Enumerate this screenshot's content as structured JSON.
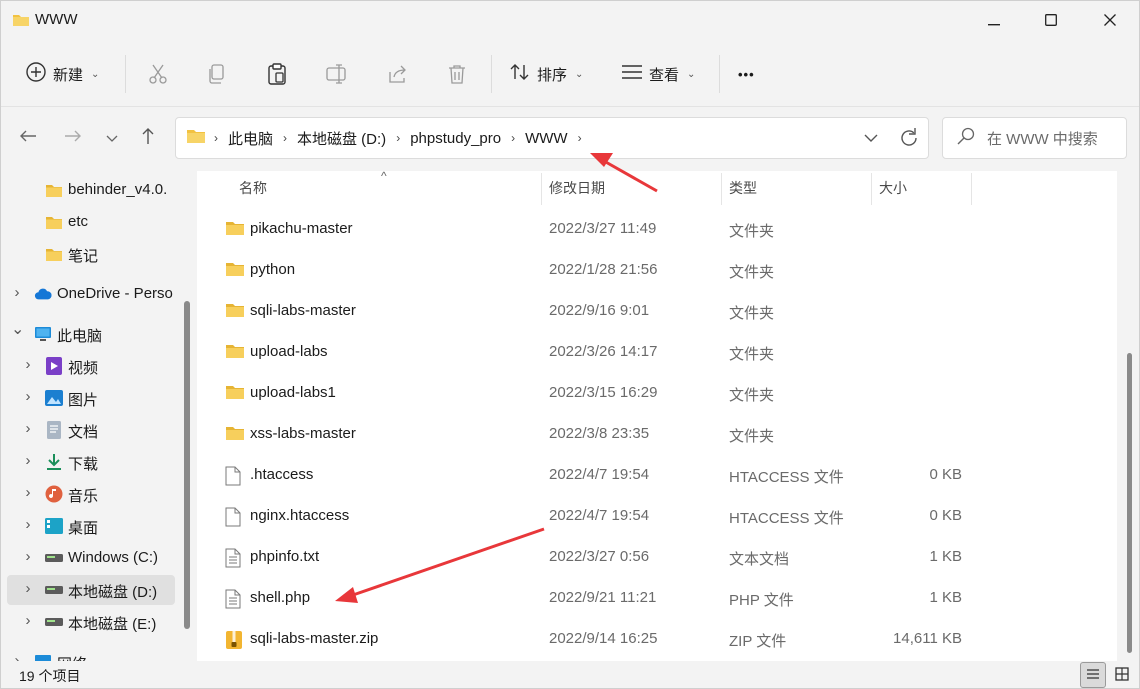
{
  "window": {
    "title": "WWW",
    "minimize_icon": "minimize-icon",
    "maximize_icon": "maximize-icon",
    "close_icon": "close-icon"
  },
  "toolbar": {
    "new_label": "新建",
    "sort_label": "排序",
    "view_label": "查看",
    "more_label": "•••",
    "icons": [
      "plus-circle-icon",
      "cut-icon",
      "copy-icon",
      "paste-icon",
      "rename-icon",
      "share-icon",
      "delete-icon",
      "sort-icon",
      "view-icon",
      "more-icon"
    ]
  },
  "address": {
    "crumbs": [
      "此电脑",
      "本地磁盘 (D:)",
      "phpstudy_pro",
      "WWW"
    ],
    "search_placeholder": "在 WWW 中搜索"
  },
  "sidebar": {
    "items": [
      {
        "label": "behinder_v4.0.",
        "icon": "folder-icon",
        "expandable": false,
        "indent": 1
      },
      {
        "label": "etc",
        "icon": "folder-icon",
        "expandable": false,
        "indent": 1
      },
      {
        "label": "笔记",
        "icon": "folder-icon",
        "expandable": false,
        "indent": 1
      },
      {
        "label": "OneDrive - Perso",
        "icon": "cloud-icon",
        "expandable": true,
        "indent": 0
      },
      {
        "label": "此电脑",
        "icon": "computer-icon",
        "expandable": true,
        "expanded": true,
        "indent": 0
      },
      {
        "label": "视频",
        "icon": "video-icon",
        "expandable": true,
        "indent": 1
      },
      {
        "label": "图片",
        "icon": "picture-icon",
        "expandable": true,
        "indent": 1
      },
      {
        "label": "文档",
        "icon": "document-icon",
        "expandable": true,
        "indent": 1
      },
      {
        "label": "下载",
        "icon": "download-icon",
        "expandable": true,
        "indent": 1
      },
      {
        "label": "音乐",
        "icon": "music-icon",
        "expandable": true,
        "indent": 1
      },
      {
        "label": "桌面",
        "icon": "desktop-icon",
        "expandable": true,
        "indent": 1
      },
      {
        "label": "Windows (C:)",
        "icon": "drive-icon",
        "expandable": true,
        "indent": 1
      },
      {
        "label": "本地磁盘 (D:)",
        "icon": "drive-icon",
        "expandable": true,
        "indent": 1,
        "selected": true
      },
      {
        "label": "本地磁盘 (E:)",
        "icon": "drive-icon",
        "expandable": true,
        "indent": 1
      },
      {
        "label": "网络",
        "icon": "network-icon",
        "expandable": true,
        "indent": 0
      }
    ]
  },
  "columns": {
    "name": "名称",
    "date": "修改日期",
    "type": "类型",
    "size": "大小"
  },
  "files": [
    {
      "name": "pikachu-master",
      "date": "2022/3/27 11:49",
      "type": "文件夹",
      "size": "",
      "icon": "folder-icon"
    },
    {
      "name": "python",
      "date": "2022/1/28 21:56",
      "type": "文件夹",
      "size": "",
      "icon": "folder-icon"
    },
    {
      "name": "sqli-labs-master",
      "date": "2022/9/16 9:01",
      "type": "文件夹",
      "size": "",
      "icon": "folder-icon"
    },
    {
      "name": "upload-labs",
      "date": "2022/3/26 14:17",
      "type": "文件夹",
      "size": "",
      "icon": "folder-icon"
    },
    {
      "name": "upload-labs1",
      "date": "2022/3/15 16:29",
      "type": "文件夹",
      "size": "",
      "icon": "folder-icon"
    },
    {
      "name": "xss-labs-master",
      "date": "2022/3/8 23:35",
      "type": "文件夹",
      "size": "",
      "icon": "folder-icon"
    },
    {
      "name": ".htaccess",
      "date": "2022/4/7 19:54",
      "type": "HTACCESS 文件",
      "size": "0 KB",
      "icon": "blank-file-icon"
    },
    {
      "name": "nginx.htaccess",
      "date": "2022/4/7 19:54",
      "type": "HTACCESS 文件",
      "size": "0 KB",
      "icon": "blank-file-icon"
    },
    {
      "name": "phpinfo.txt",
      "date": "2022/3/27 0:56",
      "type": "文本文档",
      "size": "1 KB",
      "icon": "text-file-icon"
    },
    {
      "name": "shell.php",
      "date": "2022/9/21 11:21",
      "type": "PHP 文件",
      "size": "1 KB",
      "icon": "text-file-icon"
    },
    {
      "name": "sqli-labs-master.zip",
      "date": "2022/9/14 16:25",
      "type": "ZIP 文件",
      "size": "14,611 KB",
      "icon": "zip-icon"
    }
  ],
  "status": {
    "count": "19 个项目"
  },
  "colors": {
    "folder": "#f2c241",
    "annotation_arrow": "#e8373a",
    "selected_bg": "#e0e0e0"
  }
}
